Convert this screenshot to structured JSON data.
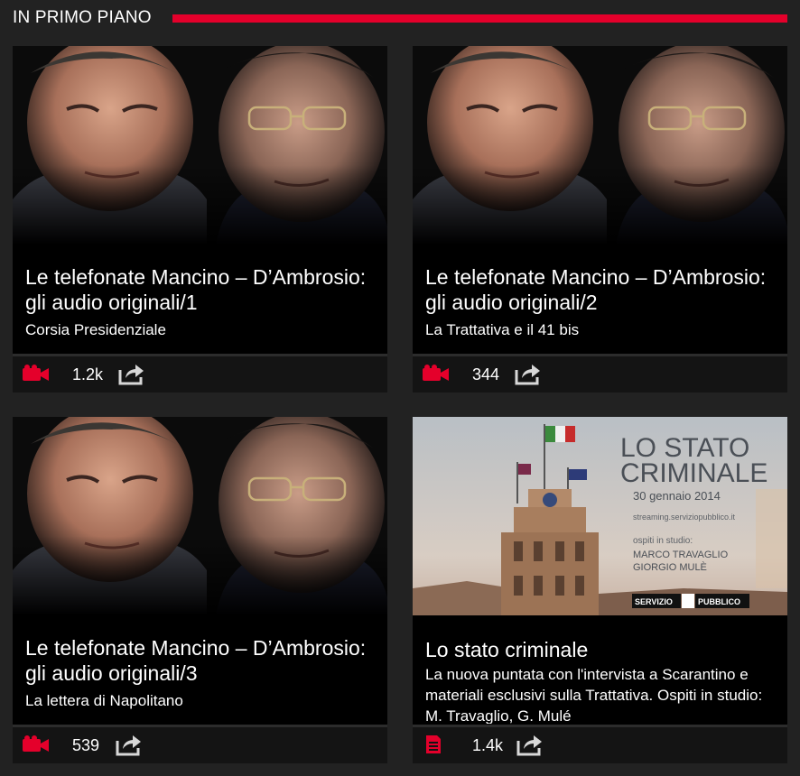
{
  "section": {
    "title": "IN PRIMO PIANO",
    "accent_color": "#e4002b"
  },
  "cards": [
    {
      "title": "Le telefonate Mancino – D’Ambrosio: gli audio originali/1",
      "subtitle": "Corsia Presidenziale",
      "type_icon": "video-camera-icon",
      "count": "1.2k",
      "share_icon": "share-icon"
    },
    {
      "title": "Le telefonate Mancino – D’Ambrosio: gli audio originali/2",
      "subtitle": "La Trattativa e il 41 bis",
      "type_icon": "video-camera-icon",
      "count": "344",
      "share_icon": "share-icon"
    },
    {
      "title": "Le telefonate Mancino – D’Ambrosio: gli audio originali/3",
      "subtitle": "La lettera di Napolitano",
      "type_icon": "video-camera-icon",
      "count": "539",
      "share_icon": "share-icon"
    },
    {
      "title": "Lo stato criminale",
      "subtitle": "La nuova puntata con l'intervista a Scarantino e materiali esclusivi sulla Trattativa. Ospiti in studio: M. Travaglio, G. Mulé",
      "type_icon": "article-icon",
      "count": "1.4k",
      "share_icon": "share-icon",
      "image_text": {
        "headline_1": "LO STATO",
        "headline_2": "CRIMINALE",
        "date": "30 gennaio 2014",
        "streaming": "streaming.serviziopubblico.it",
        "guests_label": "ospiti in studio:",
        "guest_1": "MARCO TRAVAGLIO",
        "guest_2": "GIORGIO MULÈ",
        "logo_left": "SERVIZIO",
        "logo_right": "PUBBLICO"
      }
    }
  ]
}
